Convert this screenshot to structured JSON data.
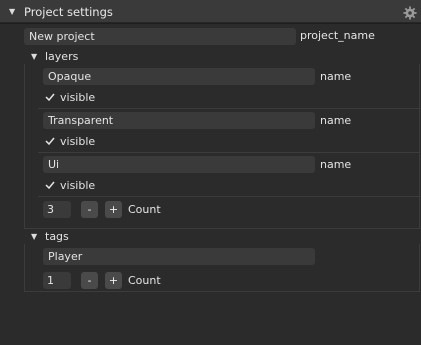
{
  "panel": {
    "title": "Project settings",
    "gear_icon": "gear-icon"
  },
  "project": {
    "name_value": "New project",
    "name_label": "project_name"
  },
  "layers": {
    "section_label": "layers",
    "items": [
      {
        "name_value": "Opaque",
        "name_label": "name",
        "visible_label": "visible",
        "visible_checked": true
      },
      {
        "name_value": "Transparent",
        "name_label": "name",
        "visible_label": "visible",
        "visible_checked": true
      },
      {
        "name_value": "Ui",
        "name_label": "name",
        "visible_label": "visible",
        "visible_checked": true
      }
    ],
    "count_value": "3",
    "minus_label": "-",
    "plus_label": "+",
    "count_label": "Count"
  },
  "tags": {
    "section_label": "tags",
    "items": [
      {
        "value": "Player"
      }
    ],
    "count_value": "1",
    "minus_label": "-",
    "plus_label": "+",
    "count_label": "Count"
  },
  "colors": {
    "background": "#2b2b2b",
    "header": "#3a3a3a",
    "field": "#3a3a3a",
    "button": "#4a4a4a",
    "text": "#e4e4e4"
  }
}
